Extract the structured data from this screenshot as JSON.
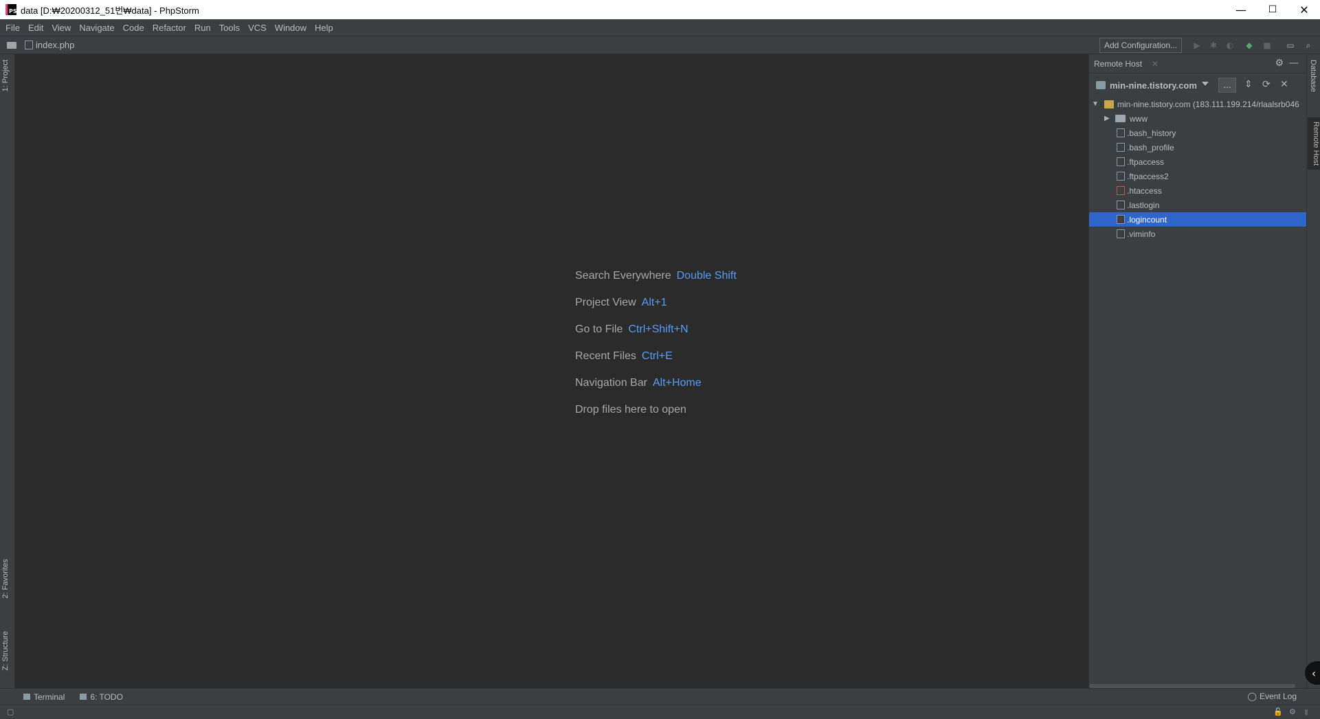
{
  "window": {
    "title": "data [D:₩20200312_51번₩data] - PhpStorm",
    "app_icon_text": "PS",
    "minimize": "—",
    "maximize": "☐",
    "close": "✕"
  },
  "menu": [
    "File",
    "Edit",
    "View",
    "Navigate",
    "Code",
    "Refactor",
    "Run",
    "Tools",
    "VCS",
    "Window",
    "Help"
  ],
  "navbar": {
    "file": "index.php",
    "add_configuration": "Add Configuration..."
  },
  "left_tabs": {
    "project": "1: Project",
    "favorites": "2: Favorites",
    "structure": "Z: Structure"
  },
  "editor_hints": [
    {
      "label": "Search Everywhere",
      "key": "Double Shift"
    },
    {
      "label": "Project View",
      "key": "Alt+1"
    },
    {
      "label": "Go to File",
      "key": "Ctrl+Shift+N"
    },
    {
      "label": "Recent Files",
      "key": "Ctrl+E"
    },
    {
      "label": "Navigation Bar",
      "key": "Alt+Home"
    },
    {
      "label": "Drop files here to open",
      "key": ""
    }
  ],
  "remote_host": {
    "panel_title": "Remote Host",
    "host": "min-nine.tistory.com",
    "more_label": "...",
    "root": "min-nine.tistory.com (183.111.199.214/rlaalsrb046",
    "folders": [
      "www"
    ],
    "files": [
      {
        "name": ".bash_history",
        "selected": false
      },
      {
        "name": ".bash_profile",
        "selected": false
      },
      {
        "name": ".ftpaccess",
        "selected": false
      },
      {
        "name": ".ftpaccess2",
        "selected": false
      },
      {
        "name": ".htaccess",
        "selected": false
      },
      {
        "name": ".lastlogin",
        "selected": false
      },
      {
        "name": ".logincount",
        "selected": true
      },
      {
        "name": ".viminfo",
        "selected": false
      }
    ]
  },
  "right_tabs": {
    "database": "Database",
    "remote_host": "Remote Host"
  },
  "bottom": {
    "terminal": "Terminal",
    "todo": "6: TODO",
    "event_log": "Event Log"
  },
  "colors": {
    "accent_key": "#589df6",
    "selection": "#2f65ca",
    "bg_editor": "#2b2b2b",
    "bg_panel": "#3c3f41"
  }
}
